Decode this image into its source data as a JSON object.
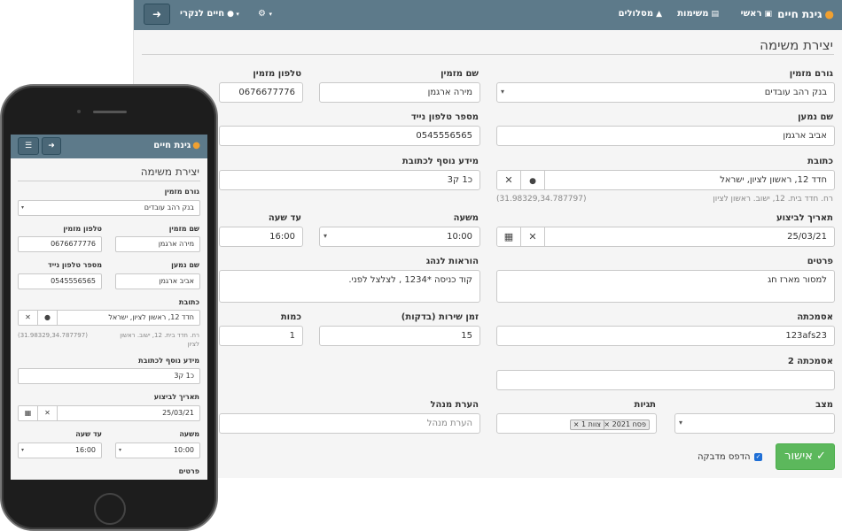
{
  "nav": {
    "brand": "גינת חיים",
    "items": {
      "home": "ראשי",
      "tasks": "משימות",
      "routes": "מסלולים",
      "user": "חיים לנקרי"
    },
    "logout_icon": "➜"
  },
  "page": {
    "title": "יצירת משימה",
    "fields": {
      "orderer": {
        "label": "גורם מזמין",
        "value": "בנק רהב עובדים"
      },
      "orderer_name": {
        "label": "שם מזמין",
        "value": "מירה ארגמן"
      },
      "orderer_phone": {
        "label": "טלפון מזמין",
        "value": "0676677776"
      },
      "recipient_name": {
        "label": "שם נמען",
        "value": "אביב ארגמן"
      },
      "mobile_phone": {
        "label": "מספר טלפון נייד",
        "value": "0545556565"
      },
      "address": {
        "label": "כתובת",
        "value": "חדד 12, ראשון לציון, ישראל"
      },
      "address_hint": "רח. חדד בית. 12, ישוב. ראשון לציון",
      "address_coords": "(31.98329,34.787797)",
      "address_extra": {
        "label": "מידע נוסף לכתובת",
        "value": "כ1 ק3"
      },
      "exec_date": {
        "label": "תאריך לביצוע",
        "value": "25/03/21"
      },
      "shift": {
        "label": "משעה",
        "value": "10:00"
      },
      "until": {
        "label": "עד שעה",
        "value": "16:00"
      },
      "details": {
        "label": "פרטים",
        "value": "למסור מארז חג"
      },
      "driver_notes": {
        "label": "הוראות לנהג",
        "value": "קוד כניסה *1234 , לצלצל לפני."
      },
      "reference": {
        "label": "אסמכתה",
        "value": "123afs23"
      },
      "service_time": {
        "label": "זמן שירות (בדקות)",
        "value": "15"
      },
      "quantity": {
        "label": "כמות",
        "value": "1"
      },
      "reference2": {
        "label": "אסמכתה 2",
        "value": ""
      },
      "status": {
        "label": "מצב",
        "value": ""
      },
      "tags": {
        "label": "תגיות",
        "items": [
          "פסח 2021",
          "צוות 1"
        ]
      },
      "manager_note": {
        "label": "הערת מנהל",
        "placeholder": "הערת מנהל"
      }
    },
    "print_label": "הדפס מדבקה",
    "submit_label": "אישור"
  }
}
